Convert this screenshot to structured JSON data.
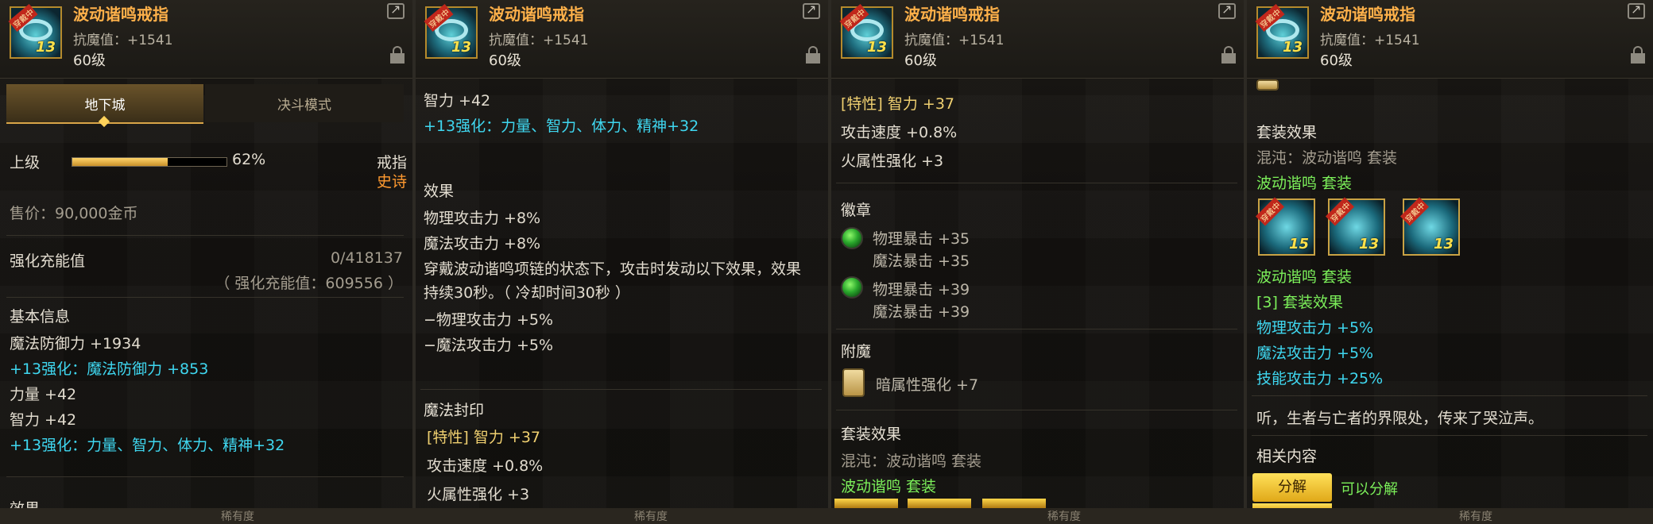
{
  "item": {
    "name": "波动谐鸣戒指",
    "resist": "抗魔值：+1541",
    "level": "60级",
    "icon_tag": "穿戴中",
    "icon_level": "13",
    "icon_name": "ring-icon"
  },
  "panel1": {
    "tabs": [
      {
        "label": "地下城"
      },
      {
        "label": "决斗模式"
      }
    ],
    "grade": "上级",
    "grade_percent": "62%",
    "grade_fill": 0.62,
    "type": "戒指",
    "rarity": "史诗",
    "price": "售价：90,000金币",
    "charge_label": "强化充能值",
    "charge_value": "0/418137",
    "charge_sub": "（ 强化充能值：609556 ）",
    "basic_title": "基本信息",
    "lines": [
      "魔法防御力 +1934",
      "+13强化：魔法防御力 +853",
      "力量 +42",
      "智力 +42",
      "+13强化：力量、智力、体力、精神+32"
    ],
    "effect_partial": "效果"
  },
  "panel2": {
    "line1": "智力 +42",
    "line2": "+13强化：力量、智力、体力、精神+32",
    "effect_title": "效果",
    "effects": [
      "物理攻击力 +8%",
      "魔法攻击力 +8%",
      "穿戴波动谐鸣项链的状态下，攻击时发动以下效果，效果",
      "持续30秒。（ 冷却时间30秒 ）",
      "−物理攻击力 +5%",
      "−魔法攻击力 +5%"
    ],
    "seal_title": "魔法封印",
    "seal_lines": [
      "[特性] 智力 +37",
      "攻击速度 +0.8%",
      "火属性强化 +3"
    ]
  },
  "panel3": {
    "seal_lines": [
      "[特性] 智力 +37",
      "攻击速度 +0.8%",
      "火属性强化 +3"
    ],
    "emblem_title": "徽章",
    "emblems": [
      [
        "物理暴击 +35",
        "魔法暴击 +35"
      ],
      [
        "物理暴击 +39",
        "魔法暴击 +39"
      ]
    ],
    "enchant_title": "附魔",
    "enchant": "暗属性强化 +7",
    "set_title": "套装效果",
    "set_line": "混沌：波动谐鸣 套装",
    "set_name": "波动谐鸣",
    "set_word": "套装"
  },
  "panel4": {
    "set_title": "套装效果",
    "set_line": "混沌：波动谐鸣 套装",
    "set_name": "波动谐鸣",
    "set_word": "套装",
    "icons": [
      {
        "tag": "穿戴中",
        "num": "15",
        "name": "set-item-1-icon"
      },
      {
        "tag": "穿戴中",
        "num": "13",
        "name": "set-item-2-icon"
      },
      {
        "tag": "穿戴中",
        "num": "13",
        "name": "set-item-3-icon"
      }
    ],
    "set_name2": "波动谐鸣",
    "set_word2": "套装",
    "set3": "[3] 套装效果",
    "bonus": [
      "物理攻击力 +5%",
      "魔法攻击力 +5%",
      "技能攻击力 +25%"
    ],
    "flavor": "听，生者与亡者的界限处，传来了哭泣声。",
    "related_title": "相关内容",
    "disassemble": "分解",
    "can_disassemble": "可以分解"
  },
  "bottom_label": "稀有度",
  "colors": {
    "title": "#ffb14a",
    "cyan": "#3fd7f0",
    "green": "#7cf05a",
    "gold": "#f0c000"
  }
}
